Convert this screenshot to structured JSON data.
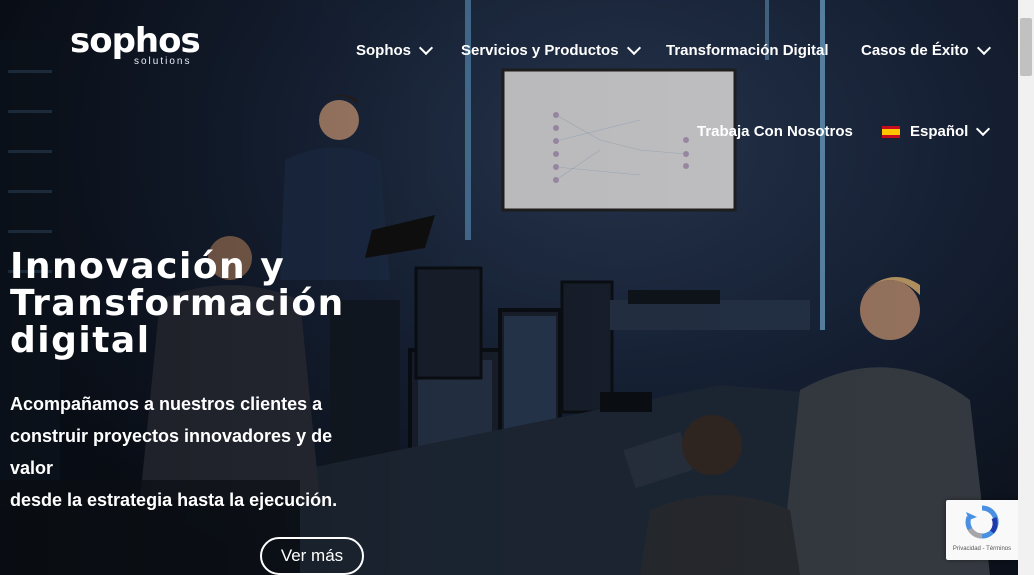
{
  "brand": {
    "name": "sophos",
    "tagline": "solutions"
  },
  "nav": {
    "items": [
      {
        "label": "Sophos",
        "has_dropdown": true
      },
      {
        "label": "Servicios y Productos",
        "has_dropdown": true
      },
      {
        "label": "Transformación Digital",
        "has_dropdown": false
      },
      {
        "label": "Casos de Éxito",
        "has_dropdown": true
      },
      {
        "label": "Trabaja Con Nosotros",
        "has_dropdown": false
      },
      {
        "label": "Español",
        "has_dropdown": true,
        "icon": "spain-flag-icon"
      }
    ]
  },
  "hero": {
    "title_lines": [
      "Innovación y",
      "Transformación",
      "digital"
    ],
    "text_lines": [
      "Acompañamos a nuestros clientes a",
      "construir proyectos innovadores y de valor",
      "desde la estrategia hasta la ejecución."
    ],
    "cta_label": "Ver más"
  },
  "recaptcha": {
    "legal": "Privacidad - Términos"
  },
  "colors": {
    "text": "#ffffff",
    "scene_dark": "#0d1520",
    "accent_glow": "#8fd3ff"
  }
}
